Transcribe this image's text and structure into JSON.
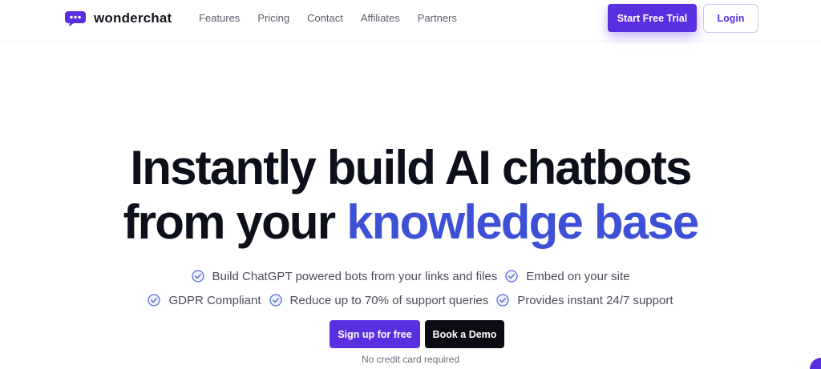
{
  "brand": {
    "name": "wonderchat",
    "logo_icon": "chat-bubble-logo"
  },
  "nav": {
    "items": [
      {
        "label": "Features"
      },
      {
        "label": "Pricing"
      },
      {
        "label": "Contact"
      },
      {
        "label": "Affiliates"
      },
      {
        "label": "Partners"
      }
    ]
  },
  "header": {
    "trial_label": "Start Free Trial",
    "login_label": "Login"
  },
  "hero": {
    "line1": "Instantly build AI chatbots",
    "line2_plain": "from your ",
    "line2_accent": "knowledge base"
  },
  "features": {
    "row1": [
      {
        "label": "Build ChatGPT powered bots from your links and files",
        "icon": "check-circle-icon"
      },
      {
        "label": "Embed on your site",
        "icon": "check-circle-icon"
      }
    ],
    "row2": [
      {
        "label": "GDPR Compliant",
        "icon": "check-circle-icon"
      },
      {
        "label": "Reduce up to 70% of support queries",
        "icon": "check-circle-icon"
      },
      {
        "label": "Provides instant 24/7 support",
        "icon": "check-circle-icon"
      }
    ]
  },
  "cta": {
    "signup_label": "Sign up for free",
    "demo_label": "Book a Demo",
    "note": "No credit card required"
  },
  "colors": {
    "brand_purple": "#5a2fe0",
    "accent_blue": "#3d51d6",
    "dark": "#0d0f1a"
  }
}
